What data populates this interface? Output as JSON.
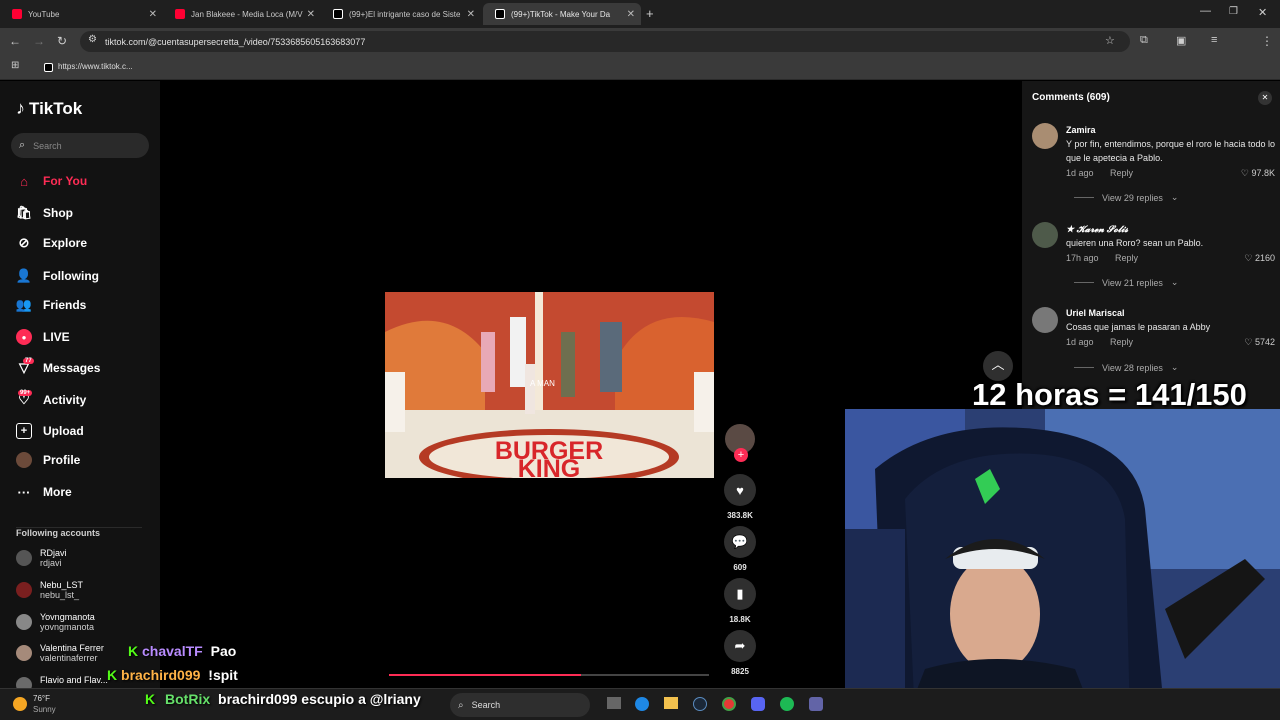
{
  "browser": {
    "tabs": [
      {
        "title": "YouTube",
        "color": "#ff0033"
      },
      {
        "title": "Jan Blakeee - Media Loca (M/V",
        "color": "#ff0033"
      },
      {
        "title": "(99+)El intrigante caso de Siste",
        "color": "#ffffff"
      },
      {
        "title": "(99+)TikTok - Make Your Da",
        "color": "#ffffff"
      }
    ],
    "url": "tiktok.com/@cuentasupersecretta_/video/7533685605163683077",
    "bookmark": "https://www.tiktok.c..."
  },
  "sidebar": {
    "logo": "TikTok",
    "search_placeholder": "Search",
    "nav": [
      {
        "label": "For You",
        "icon": "home-icon"
      },
      {
        "label": "Shop",
        "icon": "shop-icon"
      },
      {
        "label": "Explore",
        "icon": "compass-icon"
      },
      {
        "label": "Following",
        "icon": "following-icon"
      },
      {
        "label": "Friends",
        "icon": "friends-icon"
      },
      {
        "label": "LIVE",
        "icon": "live-icon"
      },
      {
        "label": "Messages",
        "icon": "messages-icon",
        "badge": "77"
      },
      {
        "label": "Activity",
        "icon": "activity-icon",
        "badge": "99+"
      },
      {
        "label": "Upload",
        "icon": "upload-icon"
      },
      {
        "label": "Profile",
        "icon": "profile-icon"
      },
      {
        "label": "More",
        "icon": "more-icon"
      }
    ],
    "following_title": "Following accounts",
    "accounts": [
      {
        "name": "RDjavi",
        "handle": "rdjavi"
      },
      {
        "name": "Nebu_LST",
        "handle": "nebu_lst_"
      },
      {
        "name": "Yovngmanota",
        "handle": "yovngmanota"
      },
      {
        "name": "Valentina Ferrer",
        "handle": "valentinaferrer"
      },
      {
        "name": "Flavio and Flav...",
        "handle": ""
      }
    ]
  },
  "video": {
    "caption_overlay": "A MAN",
    "sign_text_1": "BURGER",
    "sign_text_2": "KING",
    "progress": 0.6
  },
  "actions": {
    "likes": "383.8K",
    "comments": "609",
    "saves": "18.8K",
    "shares": "8825"
  },
  "comments": {
    "title": "Comments (609)",
    "items": [
      {
        "user": "Zamira",
        "text": "Y por fin, entendimos, porque el roro le hacia todo lo que le apetecia a Pablo.",
        "age": "1d ago",
        "reply": "Reply",
        "likes": "97.8K",
        "view_replies": "View 29 replies"
      },
      {
        "user": "★ 𝓚𝓪𝓻𝓮𝓷 𝓢𝓸𝓵𝓲𝓼",
        "text": "quieren una Roro? sean un Pablo.",
        "age": "17h ago",
        "reply": "Reply",
        "likes": "2160",
        "view_replies": "View 21 replies"
      },
      {
        "user": "Uriel Mariscal",
        "text": "Cosas que jamas le pasaran a Abby",
        "age": "1d ago",
        "reply": "Reply",
        "likes": "5742",
        "view_replies": "View 28 replies"
      }
    ]
  },
  "stream": {
    "counter": "12 horas = 141/150",
    "chat": [
      {
        "user": "chavalTF",
        "msg": "Pao",
        "color": "#b98cff"
      },
      {
        "user": "brachird099",
        "msg": "!spit",
        "color": "#ffb347"
      },
      {
        "user": "BotRix",
        "msg": "brachird099 escupio a @lriany",
        "color": "#66e06a"
      }
    ]
  },
  "taskbar": {
    "weather_temp": "76°F",
    "weather_desc": "Sunny",
    "search_placeholder": "Search"
  }
}
